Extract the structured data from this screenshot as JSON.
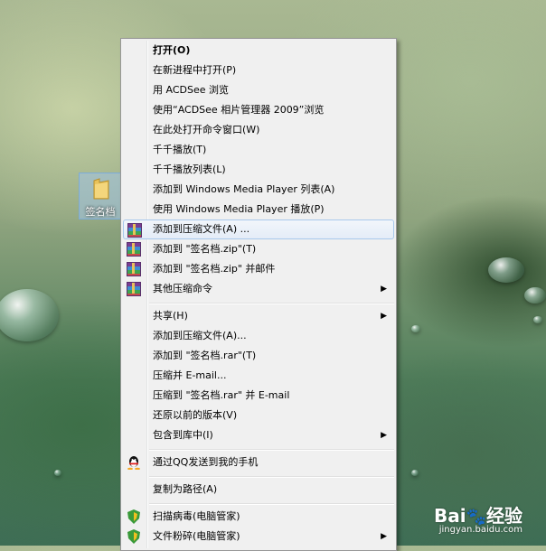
{
  "desktop": {
    "folder_label": "签名档"
  },
  "context_menu": {
    "items": [
      {
        "label": "打开(O)",
        "bold": true
      },
      {
        "label": "在新进程中打开(P)"
      },
      {
        "label": "用 ACDSee 浏览"
      },
      {
        "label": "使用“ACDSee 相片管理器 2009”浏览"
      },
      {
        "label": "在此处打开命令窗口(W)"
      },
      {
        "label": "千千播放(T)"
      },
      {
        "label": "千千播放列表(L)"
      },
      {
        "label": "添加到 Windows Media Player 列表(A)"
      },
      {
        "label": "使用 Windows Media Player 播放(P)"
      },
      {
        "label": "添加到压缩文件(A) ...",
        "icon": "winrar-icon",
        "highlighted": true
      },
      {
        "label": "添加到 \"签名档.zip\"(T)",
        "icon": "winrar-icon"
      },
      {
        "label": "添加到 \"签名档.zip\" 并邮件",
        "icon": "winrar-icon"
      },
      {
        "label": "其他压缩命令",
        "icon": "winrar-icon",
        "submenu": true
      },
      {
        "label": "共享(H)",
        "submenu": true
      },
      {
        "label": "添加到压缩文件(A)..."
      },
      {
        "label": "添加到 \"签名档.rar\"(T)"
      },
      {
        "label": "压缩并 E-mail..."
      },
      {
        "label": "压缩到 \"签名档.rar\" 并 E-mail"
      },
      {
        "label": "还原以前的版本(V)"
      },
      {
        "label": "包含到库中(I)",
        "submenu": true
      },
      {
        "label": "通过QQ发送到我的手机",
        "icon": "qq-penguin-icon"
      },
      {
        "label": "复制为路径(A)"
      },
      {
        "label": "扫描病毒(电脑管家)",
        "icon": "tencent-shield-icon"
      },
      {
        "label": "文件粉碎(电脑管家)",
        "icon": "tencent-shield-icon",
        "submenu": true
      }
    ],
    "submenu_arrow": "▶"
  },
  "watermark": {
    "brand": "Bai",
    "brand_suffix": "经验",
    "site": "jingyan.baidu.com"
  }
}
